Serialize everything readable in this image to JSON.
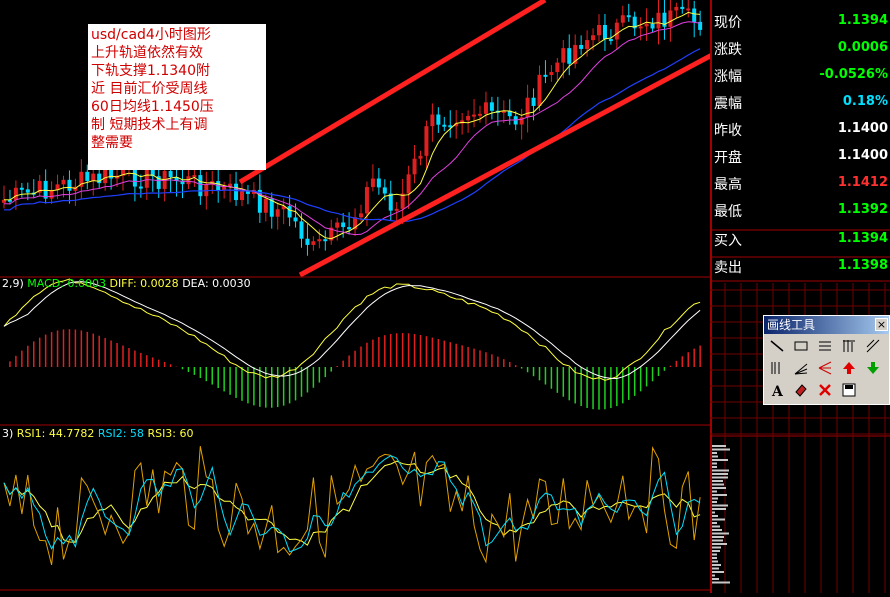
{
  "chart_data": [
    {
      "type": "candlestick",
      "title": "",
      "series": [
        {
          "name": "price"
        },
        {
          "name": "ma-yellow"
        },
        {
          "name": "ma-magenta"
        },
        {
          "name": "ma-blue"
        }
      ]
    },
    {
      "type": "line",
      "name": "MACD",
      "labels": {
        "macd": "MACD: 0.0003",
        "diff": "DIFF: 0.0028",
        "dea": "DEA: 0.0030",
        "prefix": "2,9)"
      }
    },
    {
      "type": "line",
      "name": "RSI",
      "labels": {
        "rsi1": "RSI1: 44.7782",
        "rsi2": "RSI2: 58",
        "rsi3": "RSI3: 60",
        "prefix": "3)"
      }
    }
  ],
  "annotation": {
    "lines": [
      "usd/cad4小时图形",
      "上升轨道依然有效",
      "下轨支撑1.1340附",
      "近 目前汇价受周线",
      "60日均线1.1450压",
      "制 短期技术上有调",
      "整需要"
    ]
  },
  "quote": [
    {
      "label": "现价",
      "value": "1.1394",
      "color": "#00ff00"
    },
    {
      "label": "涨跌",
      "value": "0.0006",
      "color": "#00ff00"
    },
    {
      "label": "涨幅",
      "value": "-0.0526%",
      "color": "#00ff00"
    },
    {
      "label": "震幅",
      "value": "0.18%",
      "color": "#00e0ff"
    },
    {
      "label": "昨收",
      "value": "1.1400",
      "color": "#ffffff"
    },
    {
      "label": "开盘",
      "value": "1.1400",
      "color": "#ffffff"
    },
    {
      "label": "最高",
      "value": "1.1412",
      "color": "#ff3030"
    },
    {
      "label": "最低",
      "value": "1.1392",
      "color": "#00ff00"
    },
    {
      "label": "买入",
      "value": "1.1394",
      "color": "#00ff00"
    },
    {
      "label": "卖出",
      "value": "1.1398",
      "color": "#00ff00"
    }
  ],
  "toolbox": {
    "title": "画线工具",
    "close": "×"
  },
  "colors": {
    "up": "#e02020",
    "down": "#00d8ff",
    "grid": "#800000",
    "yellow": "#ffff40",
    "magenta": "#e040e0",
    "blue": "#2040ff",
    "channel": "#ff2020"
  }
}
